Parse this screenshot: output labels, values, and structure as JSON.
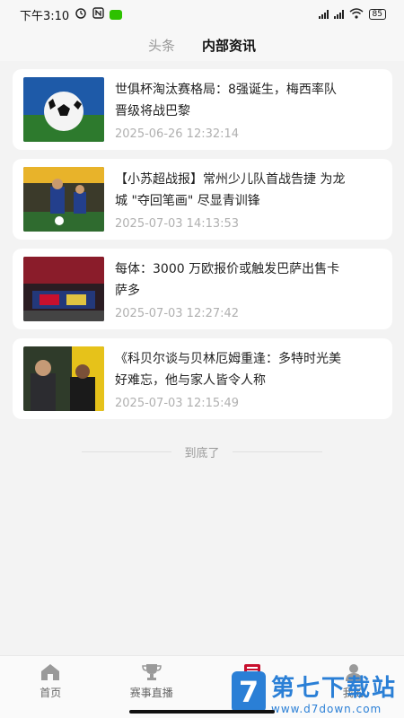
{
  "status_bar": {
    "time": "下午3:10",
    "battery": "85"
  },
  "tabs": [
    {
      "label": "头条",
      "active": false
    },
    {
      "label": "内部资讯",
      "active": true
    }
  ],
  "articles": [
    {
      "title": "世俱杯淘汰赛格局：8强诞生，梅西率队晋级将战巴黎",
      "time": "2025-06-26 12:32:14"
    },
    {
      "title": "【小苏超战报】常州少儿队首战告捷 为龙城 \"夺回笔画\" 尽显青训锋",
      "time": "2025-07-03 14:13:53"
    },
    {
      "title": "每体：3000 万欧报价或触发巴萨出售卡萨多",
      "time": "2025-07-03 12:27:42"
    },
    {
      "title": "《科贝尔谈与贝林厄姆重逢：多特时光美好难忘，他与家人皆令人称",
      "time": "2025-07-03 12:15:49"
    }
  ],
  "end_text": "到底了",
  "bottom_nav": [
    {
      "label": "首页",
      "icon": "home-icon"
    },
    {
      "label": "赛事直播",
      "icon": "trophy-icon"
    },
    {
      "label": "资讯",
      "icon": "news-icon"
    },
    {
      "label": "我的",
      "icon": "user-icon"
    }
  ],
  "watermark": {
    "logo_char": "7",
    "title": "第七下载站",
    "url": "www.d7down.com"
  },
  "colors": {
    "accent": "#c8102e",
    "watermark_blue": "#2a7fd6"
  }
}
